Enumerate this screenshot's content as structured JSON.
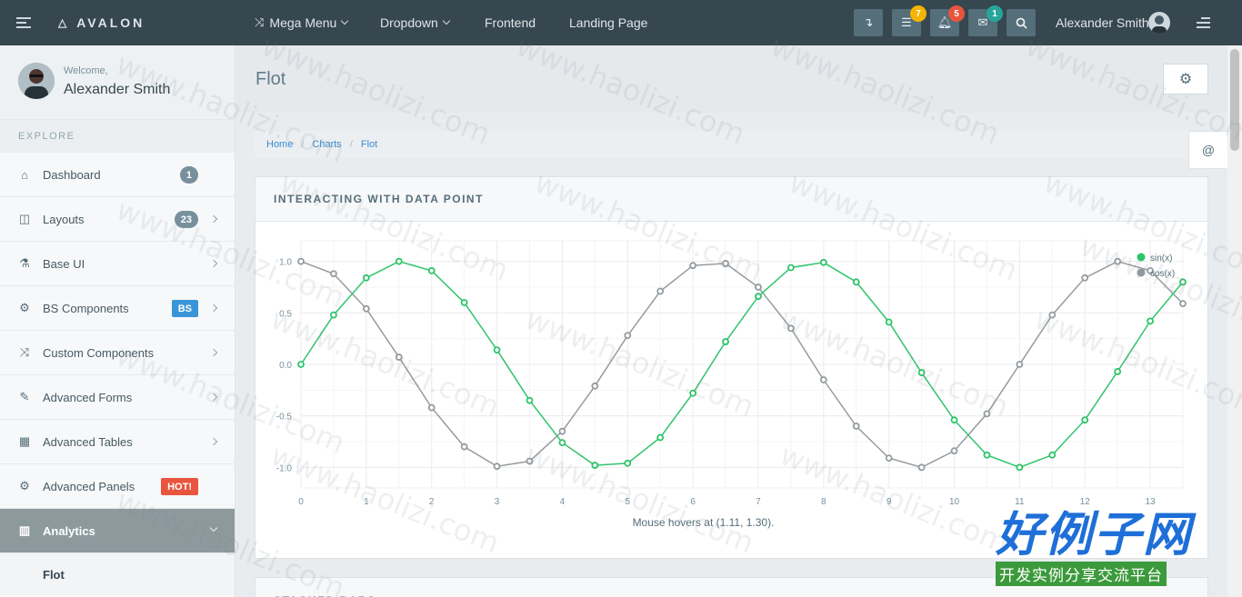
{
  "topbar": {
    "brand": "AVALON",
    "nav": [
      {
        "label": "Mega Menu",
        "icon": "shuffle-icon",
        "caret": true
      },
      {
        "label": "Dropdown",
        "caret": true
      },
      {
        "label": "Frontend"
      },
      {
        "label": "Landing Page"
      }
    ],
    "buttons": [
      {
        "icon": "download-arrow-icon"
      },
      {
        "icon": "list-icon",
        "badge": "7",
        "badge_color": "#f5b400"
      },
      {
        "icon": "bell-icon",
        "badge": "5",
        "badge_color": "#e8543e"
      },
      {
        "icon": "mail-icon",
        "badge": "1",
        "badge_color": "#26a69a"
      },
      {
        "icon": "search-icon"
      }
    ],
    "user_name": "Alexander Smith"
  },
  "sidebar": {
    "welcome": "Welcome,",
    "user_name": "Alexander Smith",
    "section_label": "EXPLORE",
    "items": [
      {
        "label": "Dashboard",
        "icon": "home-icon",
        "badge": "1",
        "badge_color": "#78909c",
        "chevron": false
      },
      {
        "label": "Layouts",
        "icon": "columns-icon",
        "badge": "23",
        "badge_color": "#78909c",
        "chevron": true
      },
      {
        "label": "Base UI",
        "icon": "flask-icon",
        "chevron": true
      },
      {
        "label": "BS Components",
        "icon": "cogs-icon",
        "badge": "BS",
        "badge_color": "#3a95d8",
        "chevron": true
      },
      {
        "label": "Custom Components",
        "icon": "shuffle-icon",
        "chevron": true
      },
      {
        "label": "Advanced Forms",
        "icon": "pencil-icon",
        "chevron": true
      },
      {
        "label": "Advanced Tables",
        "icon": "table-icon",
        "chevron": true
      },
      {
        "label": "Advanced Panels",
        "icon": "gear-icon",
        "badge": "HOT!",
        "badge_color": "#e8543e",
        "chevron": false
      },
      {
        "label": "Analytics",
        "icon": "bar-chart-icon",
        "active": true,
        "chevron": true
      }
    ],
    "sub_item": "Flot"
  },
  "page": {
    "title": "Flot",
    "breadcrumb": [
      "Home",
      "Charts",
      "Flot"
    ]
  },
  "panel": {
    "title": "INTERACTING WITH DATA POINT",
    "hover_text": "Mouse hovers at (1.11, 1.30)."
  },
  "panel2": {
    "title": "STACKED BARS"
  },
  "chart_data": {
    "type": "line",
    "title": "",
    "xlabel": "",
    "ylabel": "",
    "xlim": [
      0,
      13.5
    ],
    "ylim": [
      -1.2,
      1.2
    ],
    "xticks": [
      "0",
      "1",
      "2",
      "3",
      "4",
      "5",
      "6",
      "7",
      "8",
      "9",
      "10",
      "11",
      "12",
      "13"
    ],
    "yticks": [
      "1.0",
      "0.5",
      "0.0",
      "-0.5",
      "-1.0"
    ],
    "ytick_values": [
      1.0,
      0.5,
      0.0,
      -0.5,
      -1.0
    ],
    "grid": true,
    "legend_position": "top-right",
    "x": [
      0,
      0.5,
      1,
      1.5,
      2,
      2.5,
      3,
      3.5,
      4,
      4.5,
      5,
      5.5,
      6,
      6.5,
      7,
      7.5,
      8,
      8.5,
      9,
      9.5,
      10,
      10.5,
      11,
      11.5,
      12,
      12.5,
      13,
      13.5
    ],
    "series": [
      {
        "name": "sin(x)",
        "color": "#2ec46a",
        "values": [
          0.0,
          0.48,
          0.84,
          1.0,
          0.91,
          0.6,
          0.14,
          -0.35,
          -0.76,
          -0.98,
          -0.96,
          -0.71,
          -0.28,
          0.22,
          0.66,
          0.94,
          0.99,
          0.8,
          0.41,
          -0.08,
          -0.54,
          -0.88,
          -1.0,
          -0.88,
          -0.54,
          -0.07,
          0.42,
          0.8
        ]
      },
      {
        "name": "cos(x)",
        "color": "#949b9f",
        "values": [
          1.0,
          0.88,
          0.54,
          0.07,
          -0.42,
          -0.8,
          -0.99,
          -0.94,
          -0.65,
          -0.21,
          0.28,
          0.71,
          0.96,
          0.98,
          0.75,
          0.35,
          -0.15,
          -0.6,
          -0.91,
          -1.0,
          -0.84,
          -0.48,
          0.0,
          0.48,
          0.84,
          1.0,
          0.91,
          0.59
        ]
      }
    ]
  },
  "watermark": {
    "url": "www.haolizi.com",
    "brand": "好例子网",
    "tagline": "开发实例分享交流平台"
  }
}
